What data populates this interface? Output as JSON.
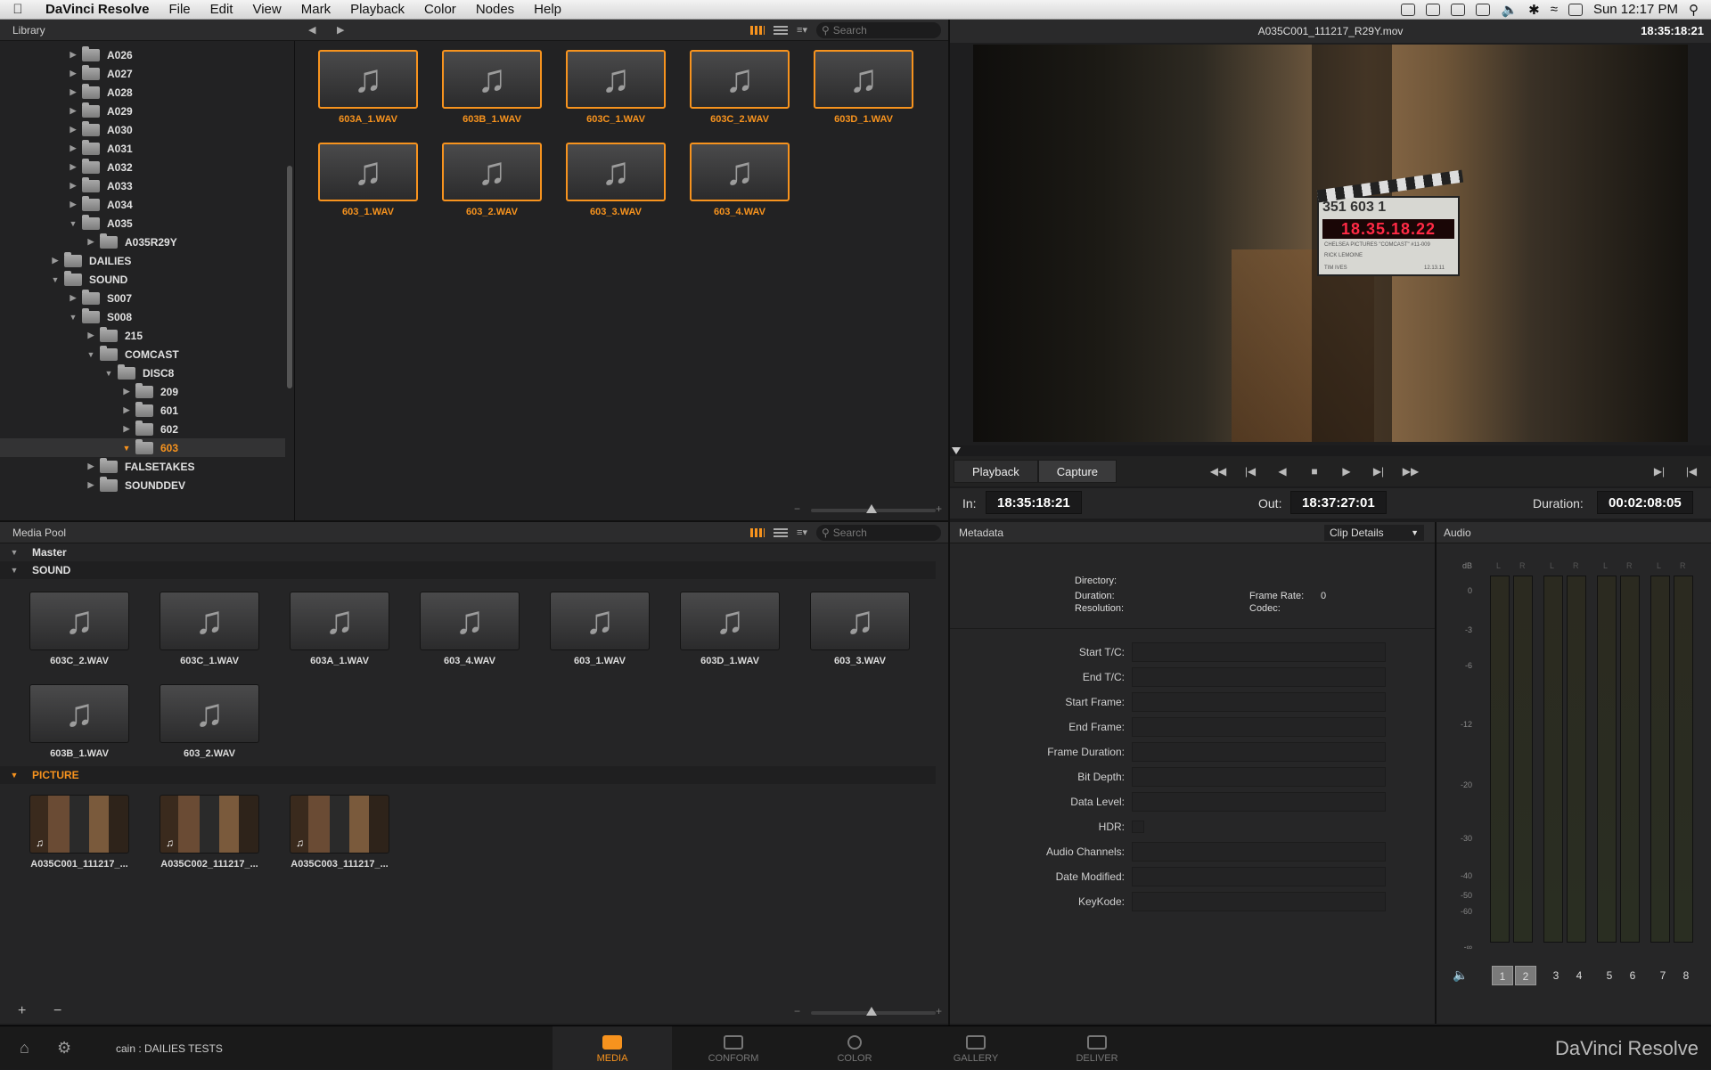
{
  "menubar": {
    "app_name": "DaVinci Resolve",
    "items": [
      "File",
      "Edit",
      "View",
      "Mark",
      "Playback",
      "Color",
      "Nodes",
      "Help"
    ],
    "clock": "Sun 12:17 PM"
  },
  "library": {
    "title": "Library",
    "search_placeholder": "Search",
    "tree": [
      {
        "label": "A026",
        "level": 4,
        "expanded": false
      },
      {
        "label": "A027",
        "level": 4,
        "expanded": false
      },
      {
        "label": "A028",
        "level": 4,
        "expanded": false
      },
      {
        "label": "A029",
        "level": 4,
        "expanded": false
      },
      {
        "label": "A030",
        "level": 4,
        "expanded": false
      },
      {
        "label": "A031",
        "level": 4,
        "expanded": false
      },
      {
        "label": "A032",
        "level": 4,
        "expanded": false
      },
      {
        "label": "A033",
        "level": 4,
        "expanded": false
      },
      {
        "label": "A034",
        "level": 4,
        "expanded": false
      },
      {
        "label": "A035",
        "level": 4,
        "expanded": true
      },
      {
        "label": "A035R29Y",
        "level": 5,
        "expanded": false
      },
      {
        "label": "DAILIES",
        "level": 3,
        "expanded": false
      },
      {
        "label": "SOUND",
        "level": 3,
        "expanded": true
      },
      {
        "label": "S007",
        "level": 4,
        "expanded": false
      },
      {
        "label": "S008",
        "level": 4,
        "expanded": true
      },
      {
        "label": "215",
        "level": 5,
        "expanded": false
      },
      {
        "label": "COMCAST",
        "level": 5,
        "expanded": true
      },
      {
        "label": "DISC8",
        "level": 6,
        "expanded": true
      },
      {
        "label": "209",
        "level": 7,
        "expanded": false
      },
      {
        "label": "601",
        "level": 7,
        "expanded": false
      },
      {
        "label": "602",
        "level": 7,
        "expanded": false
      },
      {
        "label": "603",
        "level": 7,
        "expanded": true,
        "selected": true
      },
      {
        "label": "FALSETAKES",
        "level": 5,
        "expanded": false
      },
      {
        "label": "SOUNDDEV",
        "level": 5,
        "expanded": false
      }
    ],
    "clips": [
      "603A_1.WAV",
      "603B_1.WAV",
      "603C_1.WAV",
      "603C_2.WAV",
      "603D_1.WAV",
      "603_1.WAV",
      "603_2.WAV",
      "603_3.WAV",
      "603_4.WAV"
    ]
  },
  "media_pool": {
    "title": "Media Pool",
    "search_placeholder": "Search",
    "bins": {
      "master": "Master",
      "sound": "SOUND",
      "picture": "PICTURE"
    },
    "sound_clips": [
      "603C_2.WAV",
      "603C_1.WAV",
      "603A_1.WAV",
      "603_4.WAV",
      "603_1.WAV",
      "603D_1.WAV",
      "603_3.WAV",
      "603B_1.WAV",
      "603_2.WAV"
    ],
    "picture_clips": [
      "A035C001_111217_...",
      "A035C002_111217_...",
      "A035C003_111217_..."
    ]
  },
  "viewer": {
    "clip_name": "A035C001_111217_R29Y.mov",
    "timecode": "18:35:18:21",
    "slate_scene": "351  603  1",
    "slate_tc": "18.35.18.22",
    "slate_prod": "CHELSEA PICTURES \"COMCAST\" #11-009",
    "slate_dir": "RICK LEMOINE",
    "slate_cam": "TIM IVES",
    "slate_date": "12.13.11"
  },
  "transport": {
    "tab_playback": "Playback",
    "tab_capture": "Capture",
    "in_label": "In:",
    "in_value": "18:35:18:21",
    "out_label": "Out:",
    "out_value": "18:37:27:01",
    "duration_label": "Duration:",
    "duration_value": "00:02:08:05"
  },
  "metadata": {
    "title": "Metadata",
    "dropdown": "Clip Details",
    "directory_label": "Directory:",
    "duration_label": "Duration:",
    "resolution_label": "Resolution:",
    "framerate_label": "Frame Rate:",
    "framerate_value": "0",
    "codec_label": "Codec:",
    "fields": [
      "Start T/C:",
      "End T/C:",
      "Start Frame:",
      "End Frame:",
      "Frame Duration:",
      "Bit Depth:",
      "Data Level:",
      "HDR:",
      "Audio Channels:",
      "Date Modified:",
      "KeyKode:"
    ]
  },
  "audio": {
    "title": "Audio",
    "db_label": "dB",
    "scale": [
      "0",
      "-3",
      "-6",
      "-12",
      "-20",
      "-30",
      "-40",
      "-50",
      "-60",
      "-∞"
    ],
    "meter_lr": [
      "L",
      "R",
      "L",
      "R",
      "L",
      "R",
      "L",
      "R"
    ],
    "channels": [
      "1",
      "2",
      "3",
      "4",
      "5",
      "6",
      "7",
      "8"
    ]
  },
  "bottom": {
    "project": "cain : DAILIES TESTS",
    "tabs": [
      "MEDIA",
      "CONFORM",
      "COLOR",
      "GALLERY",
      "DELIVER"
    ],
    "active_tab": "MEDIA",
    "brand": "DaVinci Resolve"
  },
  "colors": {
    "accent": "#f7931e",
    "panel": "#262627",
    "background": "#1b1b1c"
  }
}
